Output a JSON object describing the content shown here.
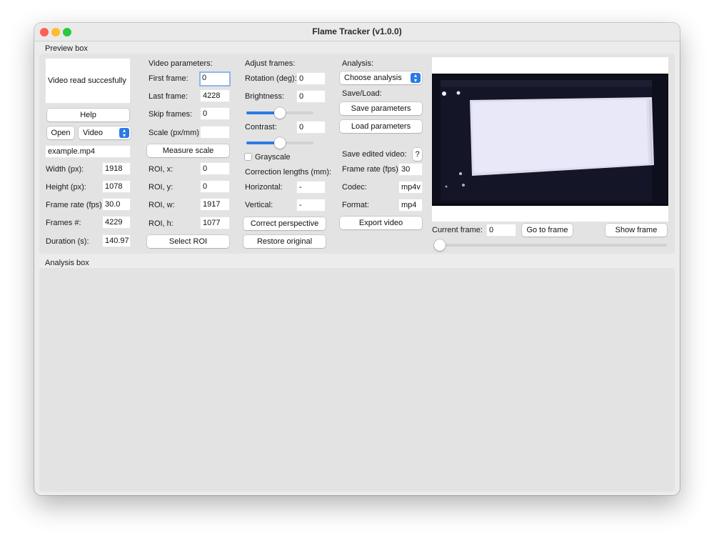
{
  "window": {
    "title": "Flame Tracker (v1.0.0)"
  },
  "preview_box": {
    "label": "Preview box",
    "status_message": "Video read succesfully",
    "help_label": "Help",
    "open_label": "Open",
    "video_type": "Video",
    "file_name": "example.mp4",
    "width_label": "Width (px):",
    "width_value": "1918",
    "height_label": "Height (px):",
    "height_value": "1078",
    "frame_rate_label": "Frame rate (fps):",
    "frame_rate_value": "30.0",
    "frames_label": "Frames #:",
    "frames_value": "4229",
    "duration_label": "Duration (s):",
    "duration_value": "140.97"
  },
  "video_parameters": {
    "heading": "Video parameters:",
    "first_frame_label": "First frame:",
    "first_frame_value": "0",
    "last_frame_label": "Last frame:",
    "last_frame_value": "4228",
    "skip_frames_label": "Skip frames:",
    "skip_frames_value": "0",
    "scale_label": "Scale (px/mm):",
    "scale_value": "",
    "measure_scale_label": "Measure scale",
    "roi_x_label": "ROI, x:",
    "roi_x_value": "0",
    "roi_y_label": "ROI, y:",
    "roi_y_value": "0",
    "roi_w_label": "ROI, w:",
    "roi_w_value": "1917",
    "roi_h_label": "ROI, h:",
    "roi_h_value": "1077",
    "select_roi_label": "Select ROI"
  },
  "adjust_frames": {
    "heading": "Adjust frames:",
    "rotation_label": "Rotation (deg):",
    "rotation_value": "0",
    "brightness_label": "Brightness:",
    "brightness_value": "0",
    "brightness_slider": 0.5,
    "contrast_label": "Contrast:",
    "contrast_value": "0",
    "contrast_slider": 0.5,
    "grayscale_label": "Grayscale",
    "correction_heading": "Correction lengths (mm):",
    "horizontal_label": "Horizontal:",
    "horizontal_value": "-",
    "vertical_label": "Vertical:",
    "vertical_value": "-",
    "correct_perspective_label": "Correct perspective",
    "restore_original_label": "Restore original"
  },
  "analysis": {
    "heading": "Analysis:",
    "choose_label": "Choose analysis",
    "save_load_heading": "Save/Load:",
    "save_params_label": "Save parameters",
    "load_params_label": "Load parameters",
    "save_edited_heading": "Save edited video:",
    "help_q_label": "?",
    "export_frame_rate_label": "Frame rate (fps):",
    "export_frame_rate_value": "30",
    "codec_label": "Codec:",
    "codec_value": "mp4v",
    "format_label": "Format:",
    "format_value": "mp4",
    "export_video_label": "Export video"
  },
  "frame_nav": {
    "current_frame_label": "Current frame:",
    "current_frame_value": "0",
    "go_to_frame_label": "Go to frame",
    "show_frame_label": "Show frame",
    "frame_slider": 0
  },
  "analysis_box": {
    "label": "Analysis box"
  },
  "colors": {
    "accent": "#2a7be4",
    "close": "#ff5f57",
    "minimize": "#febc2e",
    "zoom": "#28c840"
  }
}
